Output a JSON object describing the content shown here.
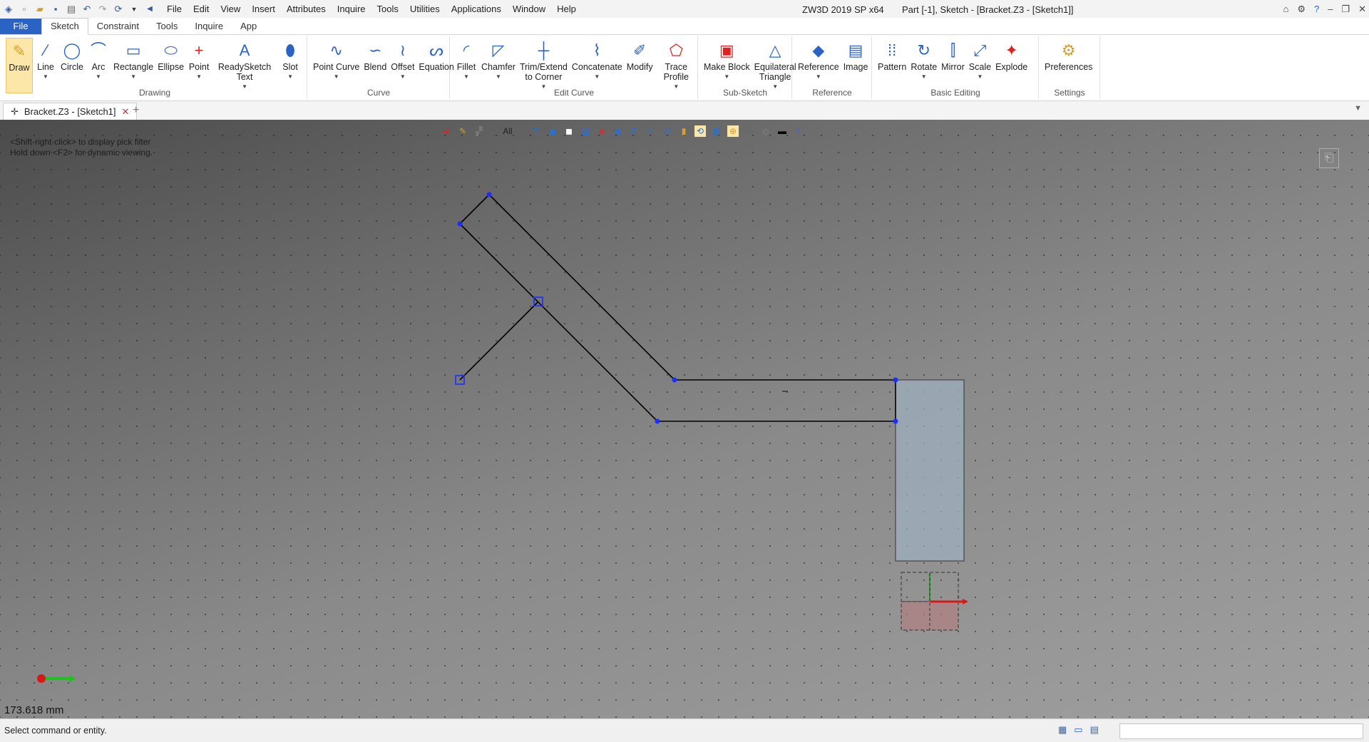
{
  "app": {
    "window_title": "ZW3D 2019 SP x64",
    "document_title": "Part [-1],  Sketch - [Bracket.Z3 - [Sketch1]]"
  },
  "menu": [
    "File",
    "Edit",
    "View",
    "Insert",
    "Attributes",
    "Inquire",
    "Tools",
    "Utilities",
    "Applications",
    "Window",
    "Help"
  ],
  "ribbon_tabs": [
    "File",
    "Sketch",
    "Constraint",
    "Tools",
    "Inquire",
    "App"
  ],
  "ribbon": {
    "drawing": {
      "title": "Drawing",
      "buttons": [
        {
          "label": "Draw",
          "icon": "pencil-icon",
          "glyph": "✎"
        },
        {
          "label": "Line",
          "icon": "line-icon",
          "glyph": "⁄"
        },
        {
          "label": "Circle",
          "icon": "circle-icon",
          "glyph": "◯"
        },
        {
          "label": "Arc",
          "icon": "arc-icon",
          "glyph": "⌒"
        },
        {
          "label": "Rectangle",
          "icon": "rectangle-icon",
          "glyph": "▭"
        },
        {
          "label": "Ellipse",
          "icon": "ellipse-icon",
          "glyph": "⬭"
        },
        {
          "label": "Point",
          "icon": "point-icon",
          "glyph": "+"
        },
        {
          "label": "ReadySketch Text",
          "icon": "text-icon",
          "glyph": "A"
        },
        {
          "label": "Slot",
          "icon": "slot-icon",
          "glyph": "⬮"
        }
      ]
    },
    "curve": {
      "title": "Curve",
      "buttons": [
        {
          "label": "Point Curve",
          "icon": "point-curve-icon",
          "glyph": "∿"
        },
        {
          "label": "Blend",
          "icon": "blend-icon",
          "glyph": "∽"
        },
        {
          "label": "Offset",
          "icon": "offset-icon",
          "glyph": "≀"
        },
        {
          "label": "Equation",
          "icon": "equation-icon",
          "glyph": "ᔕ"
        }
      ]
    },
    "edit_curve": {
      "title": "Edit Curve",
      "buttons": [
        {
          "label": "Fillet",
          "icon": "fillet-icon",
          "glyph": "◜"
        },
        {
          "label": "Chamfer",
          "icon": "chamfer-icon",
          "glyph": "◸"
        },
        {
          "label": "Trim/Extend to Corner",
          "icon": "trim-icon",
          "glyph": "┼"
        },
        {
          "label": "Concatenate",
          "icon": "concatenate-icon",
          "glyph": "⌇"
        },
        {
          "label": "Modify",
          "icon": "modify-icon",
          "glyph": "✐"
        },
        {
          "label": "Trace Profile",
          "icon": "trace-profile-icon",
          "glyph": "⬠"
        }
      ]
    },
    "sub_sketch": {
      "title": "Sub-Sketch",
      "buttons": [
        {
          "label": "Make Block",
          "icon": "make-block-icon",
          "glyph": "▣"
        },
        {
          "label": "Equilateral Triangle",
          "icon": "triangle-icon",
          "glyph": "△"
        }
      ]
    },
    "reference": {
      "title": "Reference",
      "buttons": [
        {
          "label": "Reference",
          "icon": "reference-icon",
          "glyph": "◆"
        },
        {
          "label": "Image",
          "icon": "image-icon",
          "glyph": "▤"
        }
      ]
    },
    "basic_editing": {
      "title": "Basic Editing",
      "buttons": [
        {
          "label": "Pattern",
          "icon": "pattern-icon",
          "glyph": "⁞⁞"
        },
        {
          "label": "Rotate",
          "icon": "rotate-icon",
          "glyph": "↻"
        },
        {
          "label": "Mirror",
          "icon": "mirror-icon",
          "glyph": "⫿"
        },
        {
          "label": "Scale",
          "icon": "scale-icon",
          "glyph": "⤢"
        },
        {
          "label": "Explode",
          "icon": "explode-icon",
          "glyph": "✦"
        }
      ]
    },
    "settings": {
      "title": "Settings",
      "buttons": [
        {
          "label": "Preferences",
          "icon": "preferences-icon",
          "glyph": "⚙"
        }
      ]
    }
  },
  "doc_tab": {
    "label": "Bracket.Z3 - [Sketch1]",
    "close": "✕",
    "add": "+"
  },
  "viewport": {
    "hint_line1": "<Shift-right-click> to display pick filter",
    "hint_line2": "Hold down <F2> for dynamic viewing.",
    "filter": "All",
    "measurement": "173.618 mm"
  },
  "status": {
    "text": "Select command or entity."
  },
  "colors": {
    "accent": "#2b63c4",
    "sketch_line": "#000000",
    "vertex": "#1a2fff",
    "fill_block": "#9fb2c2",
    "axis_x": "#e02020",
    "axis_y": "#20c020"
  }
}
